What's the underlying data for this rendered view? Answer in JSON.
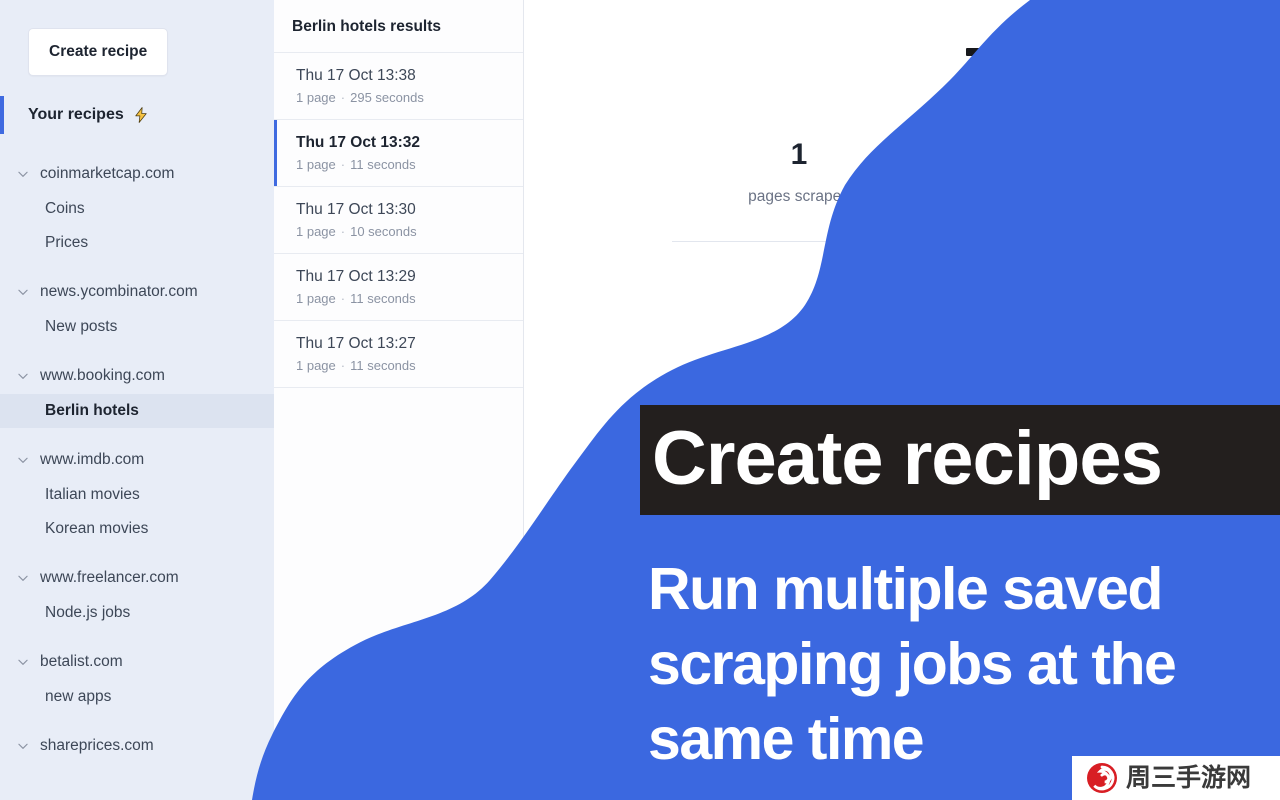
{
  "sidebar": {
    "create_button": "Create recipe",
    "section_title": "Your recipes",
    "section_icon": "lightning-bolt-icon",
    "groups": [
      {
        "domain": "coinmarketcap.com",
        "recipes": [
          "Coins",
          "Prices"
        ]
      },
      {
        "domain": "news.ycombinator.com",
        "recipes": [
          "New posts"
        ]
      },
      {
        "domain": "www.booking.com",
        "recipes": [
          "Berlin hotels"
        ]
      },
      {
        "domain": "www.imdb.com",
        "recipes": [
          "Italian movies",
          "Korean movies"
        ]
      },
      {
        "domain": "www.freelancer.com",
        "recipes": [
          "Node.js jobs"
        ]
      },
      {
        "domain": "betalist.com",
        "recipes": [
          "new apps"
        ]
      },
      {
        "domain": "shareprices.com",
        "recipes": []
      }
    ],
    "selected_recipe": "Berlin hotels"
  },
  "results": {
    "header": "Berlin hotels results",
    "items": [
      {
        "timestamp": "Thu 17 Oct 13:38",
        "pages": "1 page",
        "duration": "295 seconds",
        "active": false
      },
      {
        "timestamp": "Thu 17 Oct 13:32",
        "pages": "1 page",
        "duration": "11 seconds",
        "active": true
      },
      {
        "timestamp": "Thu 17 Oct 13:30",
        "pages": "1 page",
        "duration": "10 seconds",
        "active": false
      },
      {
        "timestamp": "Thu 17 Oct 13:29",
        "pages": "1 page",
        "duration": "11 seconds",
        "active": false
      },
      {
        "timestamp": "Thu 17 Oct 13:27",
        "pages": "1 page",
        "duration": "11 seconds",
        "active": false
      }
    ],
    "separator": "·"
  },
  "main": {
    "stat_value": "1",
    "stat_label": "pages scraped"
  },
  "promo": {
    "title": "Create recipes",
    "subtitle": "Run multiple saved scraping jobs at the same time"
  },
  "watermark": {
    "text": "周三手游网",
    "logo": "spiral-logo-icon"
  },
  "colors": {
    "accent_blue": "#3f6ae0",
    "wave_blue": "#3b68e0",
    "sidebar_bg": "#e8edf7",
    "promo_bar_bg": "#231f1e",
    "selected_item_bg": "#dce3f0",
    "watermark_red": "#d81e24"
  }
}
